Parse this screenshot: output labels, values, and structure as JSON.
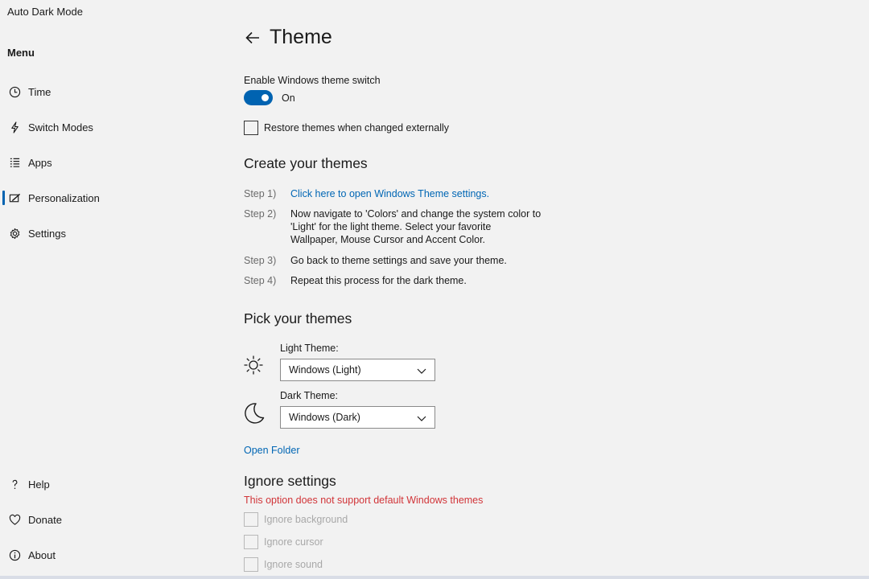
{
  "app": {
    "title": "Auto Dark Mode"
  },
  "sidebar": {
    "heading": "Menu",
    "items": [
      {
        "label": "Time",
        "icon": "clock-icon"
      },
      {
        "label": "Switch Modes",
        "icon": "lightning-icon"
      },
      {
        "label": "Apps",
        "icon": "list-icon"
      },
      {
        "label": "Personalization",
        "icon": "personalization-icon",
        "selected": true
      },
      {
        "label": "Settings",
        "icon": "gear-icon"
      }
    ],
    "bottom_items": [
      {
        "label": "Help",
        "icon": "question-icon"
      },
      {
        "label": "Donate",
        "icon": "heart-icon"
      },
      {
        "label": "About",
        "icon": "info-icon"
      }
    ]
  },
  "page": {
    "title": "Theme",
    "enable_label": "Enable Windows theme switch",
    "toggle_state": "On",
    "restore_label": "Restore themes when changed externally"
  },
  "create": {
    "title": "Create your themes",
    "steps": [
      {
        "label": "Step 1)",
        "text": "Click here to open Windows Theme settings."
      },
      {
        "label": "Step 2)",
        "text_lines": [
          "Now navigate to 'Colors' and change the system color to",
          "'Light' for the light theme. Select your favorite",
          "Wallpaper, Mouse Cursor and Accent Color."
        ]
      },
      {
        "label": "Step 3)",
        "text": "Go back to theme settings and save your theme."
      },
      {
        "label": "Step 4)",
        "text": "Repeat this process for the dark theme."
      }
    ]
  },
  "pick": {
    "title": "Pick your themes",
    "light_label": "Light Theme:",
    "light_value": "Windows (Light)",
    "dark_label": "Dark Theme:",
    "dark_value": "Windows (Dark)",
    "open_folder": "Open Folder"
  },
  "ignore": {
    "title": "Ignore settings",
    "warning": "This option does not support default Windows themes",
    "options": [
      "Ignore background",
      "Ignore cursor",
      "Ignore sound"
    ]
  },
  "colors": {
    "accent": "#0063b1",
    "link": "#0066b4",
    "warning": "#d13438",
    "background": "#f2f2f2"
  }
}
